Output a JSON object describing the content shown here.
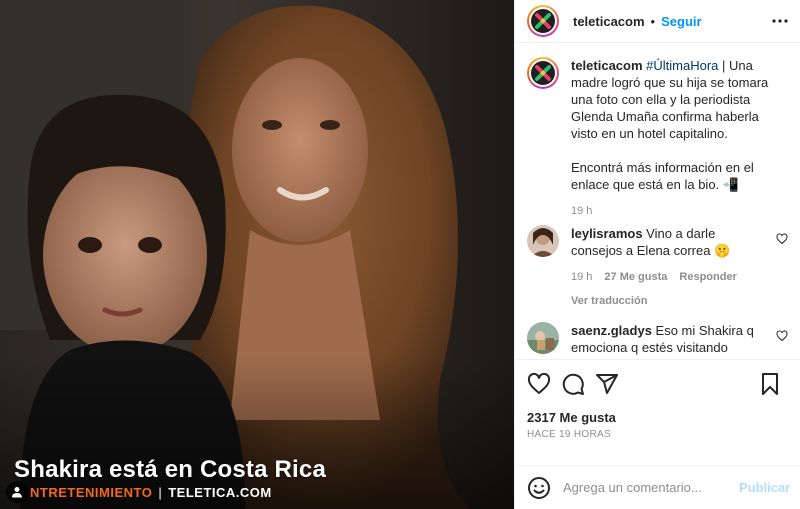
{
  "media": {
    "title": "Shakira está en Costa Rica",
    "section_label": "NTRETENIMIENTO",
    "separator": "|",
    "brand_label": "TELETICA.COM"
  },
  "header": {
    "username": "teleticacom",
    "dot": "•",
    "follow_label": "Seguir"
  },
  "caption": {
    "username": "teleticacom",
    "hashtag": "#ÚltimaHora",
    "text1": " | Una madre logró que su hija se tomara una foto con ella y la periodista Glenda Umaña confirma haberla visto en un hotel capitalino.",
    "text2": "Encontrá más información en el enlace que está en la bio. 📲",
    "time": "19 h"
  },
  "comments": [
    {
      "username": "leylisramos",
      "text": " Vino a darle consejos a Elena correa 🤫",
      "time": "19 h",
      "likes": "27 Me gusta",
      "reply": "Responder",
      "translate": "Ver traducción"
    },
    {
      "username": "saenz.gladys",
      "text": " Eso mi Shakira q emociona q estés visitando nuestro país hace tanto años fui a el único concierto q vi en el Estadio Nacional ojalá 🙏 y vuelva"
    }
  ],
  "actions": {
    "likes": "2317 Me gusta",
    "time_ago": "HACE 19 HORAS"
  },
  "add_comment": {
    "placeholder": "Agrega un comentario...",
    "publish_label": "Publicar"
  },
  "icons": [
    "user-tag-icon",
    "more-icon",
    "heart-icon",
    "comment-icon",
    "share-icon",
    "save-icon",
    "emoji-icon",
    "heart-small-icon"
  ],
  "colors": {
    "accent": "#0095f6",
    "publish_disabled": "#b2dffc",
    "brand_orange": "#f26a1b",
    "muted": "#8e8e8e"
  }
}
